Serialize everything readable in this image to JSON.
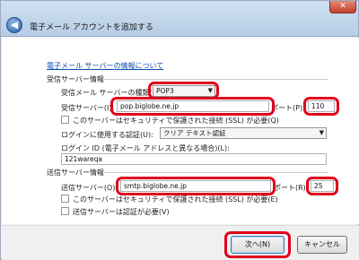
{
  "window": {
    "title": "電子メール アカウントを追加する",
    "back_glyph": "◀",
    "close_glyph": "✕"
  },
  "help_link": "電子メール サーバーの情報について",
  "incoming": {
    "section_label": "受信サーバー情報",
    "type_label": "受信メール サーバーの種類(M):",
    "type_value": "POP3",
    "server_label": "受信サーバー(I):",
    "server_value": "pop.biglobe.ne.jp",
    "port_label": "ポート(P):",
    "port_value": "110",
    "ssl_label": "このサーバーはセキュリティで保護された接続 (SSL) が必要(Q)",
    "auth_label": "ログインに使用する認証(U):",
    "auth_value": "クリア テキスト認証",
    "login_id_label": "ログイン ID (電子メール アドレスと異なる場合)(L):",
    "login_id_value": "121wareqa"
  },
  "outgoing": {
    "section_label": "送信サーバー情報",
    "server_label": "送信サーバー(O):",
    "server_value": "smtp.biglobe.ne.jp",
    "port_label": "ポート(R):",
    "port_value": "25",
    "ssl_label": "このサーバーはセキュリティで保護された接続 (SSL) が必要(E)",
    "auth_required_label": "送信サーバーは認証が必要(V)"
  },
  "buttons": {
    "next": "次へ(N)",
    "cancel": "キャンセル"
  },
  "colors": {
    "highlight": "#e0001a",
    "link": "#0b4fb0"
  }
}
